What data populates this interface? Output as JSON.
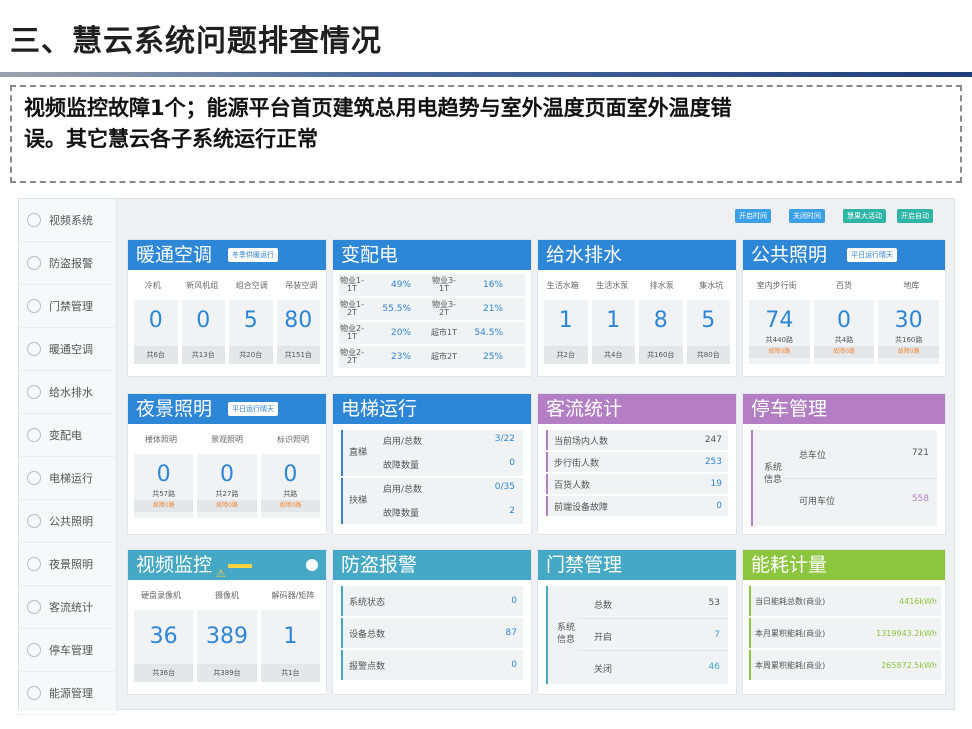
{
  "slide": {
    "title": "三、慧云系统问题排查情况",
    "summary_line1": "视频监控故障1个；能源平台首页建筑总用电趋势与室外温度页面室外温度错",
    "summary_line2": "误。其它慧云各子系统运行正常"
  },
  "sidebar": {
    "items": [
      "视频系统",
      "防盗报警",
      "门禁管理",
      "暖通空调",
      "给水排水",
      "变配电",
      "电梯运行",
      "公共照明",
      "夜景照明",
      "客流统计",
      "停车管理",
      "能源管理"
    ]
  },
  "topbar": {
    "buttons": [
      "开启时间",
      "关闭时间",
      "慧果大活动",
      "开启自动"
    ]
  },
  "hvac": {
    "title": "暖通空调",
    "dropdown": "冬季供暖运行",
    "labels": [
      "冷机",
      "新风机组",
      "组合空调",
      "吊装空调"
    ],
    "values": [
      "0",
      "0",
      "5",
      "80"
    ],
    "subs": [
      "共6台",
      "共13台",
      "共20台",
      "共151台"
    ]
  },
  "power": {
    "title": "变配电",
    "rows": [
      {
        "k1": "物业1-1T",
        "v1": "49%",
        "k2": "物业3-1T",
        "v2": "16%"
      },
      {
        "k1": "物业1-2T",
        "v1": "55.5%",
        "k2": "物业3-2T",
        "v2": "21%"
      },
      {
        "k1": "物业2-1T",
        "v1": "20%",
        "k2": "超市1T",
        "v2": "54.5%"
      },
      {
        "k1": "物业2-2T",
        "v1": "23%",
        "k2": "超市2T",
        "v2": "25%"
      }
    ]
  },
  "water": {
    "title": "给水排水",
    "labels": [
      "生活水箱",
      "生活水泵",
      "排水泵",
      "集水坑"
    ],
    "values": [
      "1",
      "1",
      "8",
      "5"
    ],
    "subs": [
      "共2台",
      "共4台",
      "共160台",
      "共80台"
    ]
  },
  "lighting": {
    "title": "公共照明",
    "dropdown": "平日运行晴天",
    "labels": [
      "室内步行街",
      "百货",
      "地库"
    ],
    "values": [
      "74",
      "0",
      "30"
    ],
    "subs": [
      "共440路",
      "共4路",
      "共160路"
    ],
    "faults": [
      "故障0路",
      "故障0路",
      "故障0路"
    ]
  },
  "night": {
    "title": "夜景照明",
    "dropdown": "平日运行晴天",
    "labels": [
      "楼体照明",
      "景观照明",
      "标识照明"
    ],
    "values": [
      "0",
      "0",
      "0"
    ],
    "subs": [
      "共57路",
      "共27路",
      "共路"
    ],
    "faults": [
      "故障0路",
      "故障0路",
      "故障0路"
    ]
  },
  "elevator": {
    "title": "电梯运行",
    "groups": [
      {
        "name": "直梯",
        "rows": [
          {
            "k": "启用/总数",
            "v": "3/22"
          },
          {
            "k": "故障数量",
            "v": "0"
          }
        ]
      },
      {
        "name": "扶梯",
        "rows": [
          {
            "k": "启用/总数",
            "v": "0/35"
          },
          {
            "k": "故障数量",
            "v": "2"
          }
        ]
      }
    ]
  },
  "traffic": {
    "title": "客流统计",
    "rows": [
      {
        "k": "当前场内人数",
        "v": "247"
      },
      {
        "k": "步行街人数",
        "v": "253"
      },
      {
        "k": "百货人数",
        "v": "19"
      },
      {
        "k": "前端设备故障",
        "v": "0"
      }
    ]
  },
  "parking": {
    "title": "停车管理",
    "side": "系统信息",
    "rows": [
      {
        "k": "总车位",
        "v": "721"
      },
      {
        "k": "可用车位",
        "v": "558"
      }
    ]
  },
  "video": {
    "title": "视频监控",
    "labels": [
      "硬盘录像机",
      "摄像机",
      "解码器/矩阵"
    ],
    "values": [
      "36",
      "389",
      "1"
    ],
    "subs": [
      "共36台",
      "共389台",
      "共1台"
    ]
  },
  "alarm": {
    "title": "防盗报警",
    "rows": [
      {
        "k": "系统状态",
        "v": "0"
      },
      {
        "k": "设备总数",
        "v": "87"
      },
      {
        "k": "报警点数",
        "v": "0"
      }
    ]
  },
  "access": {
    "title": "门禁管理",
    "side": "系统信息",
    "rows": [
      {
        "k": "总数",
        "v": "53"
      },
      {
        "k": "开启",
        "v": "7"
      },
      {
        "k": "关闭",
        "v": "46"
      }
    ]
  },
  "energy": {
    "title": "能耗计量",
    "rows": [
      {
        "k": "当日能耗总数(商业)",
        "v": "4416kWh"
      },
      {
        "k": "本月累积能耗(商业)",
        "v": "1319943.2kWh"
      },
      {
        "k": "本周累积能耗(商业)",
        "v": "265872.5kWh"
      }
    ]
  }
}
